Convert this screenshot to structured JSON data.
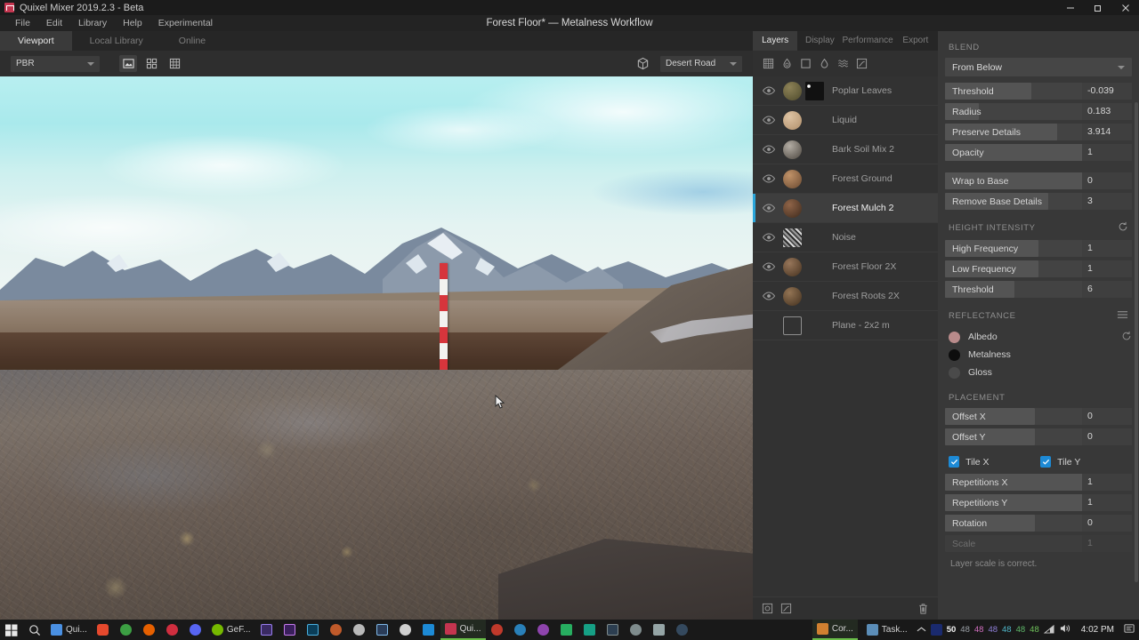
{
  "window": {
    "app_title": "Quixel Mixer 2019.2.3 - Beta",
    "document_title": "Forest Floor* — Metalness Workflow",
    "minimize": "minimize-icon",
    "restore": "restore-icon",
    "close": "close-icon"
  },
  "menu": [
    "File",
    "Edit",
    "Library",
    "Help",
    "Experimental"
  ],
  "tabs": [
    {
      "label": "Viewport",
      "active": true
    },
    {
      "label": "Local Library",
      "active": false
    },
    {
      "label": "Online",
      "active": false
    }
  ],
  "viewport_toolbar": {
    "shader_mode": "PBR",
    "view_icons": [
      "image-view-icon",
      "grid-four-view-icon",
      "grid-nine-view-icon"
    ],
    "environment_icon": "cube-icon",
    "environment": "Desert Road"
  },
  "panel_tabs": [
    {
      "label": "Layers",
      "active": true
    },
    {
      "label": "Display",
      "active": false
    },
    {
      "label": "Performance",
      "active": false
    },
    {
      "label": "Export",
      "active": false
    }
  ],
  "layer_tools": [
    "material-grid-icon",
    "paint-layer-icon",
    "solid-layer-icon",
    "liquid-layer-icon",
    "displace-layer-icon",
    "curve-layer-icon"
  ],
  "layers": [
    {
      "name": "Poplar Leaves",
      "thumb": "#6b6142",
      "mask": "stencil",
      "visible": true,
      "selected": false
    },
    {
      "name": "Liquid",
      "thumb": "#c2a487",
      "mask": null,
      "visible": true,
      "selected": false
    },
    {
      "name": "Bark Soil Mix 2",
      "thumb": "#8d857c",
      "mask": null,
      "visible": true,
      "selected": false
    },
    {
      "name": "Forest Ground",
      "thumb": "#9b7352",
      "mask": null,
      "visible": true,
      "selected": false
    },
    {
      "name": "Forest Mulch 2",
      "thumb": "#6e4c38",
      "mask": null,
      "visible": true,
      "selected": true
    },
    {
      "name": "Noise",
      "thumb": null,
      "mask": "noise",
      "visible": true,
      "selected": false
    },
    {
      "name": "Forest Floor 2X",
      "thumb": "#6d5540",
      "mask": null,
      "visible": true,
      "selected": false
    },
    {
      "name": "Forest Roots 2X",
      "thumb": "#6a5239",
      "mask": null,
      "visible": true,
      "selected": false
    },
    {
      "name": "Plane - 2x2 m",
      "thumb": null,
      "mask": null,
      "visible": false,
      "selected": false
    }
  ],
  "layer_footer": {
    "add_icon": "add-layer-icon",
    "curve_icon": "curve-icon",
    "delete_icon": "trash-icon"
  },
  "properties": {
    "blend": {
      "heading": "BLEND",
      "mode": "From Below",
      "sliders": [
        {
          "label": "Threshold",
          "value": "-0.039",
          "fill": 46
        },
        {
          "label": "Radius",
          "value": "0.183",
          "fill": 18
        },
        {
          "label": "Preserve Details",
          "value": "3.914",
          "fill": 60
        },
        {
          "label": "Opacity",
          "value": "1",
          "fill": 100
        }
      ]
    },
    "base": {
      "sliders": [
        {
          "label": "Wrap to Base",
          "value": "0",
          "fill": 100
        },
        {
          "label": "Remove Base Details",
          "value": "3",
          "fill": 55
        }
      ]
    },
    "height_intensity": {
      "heading": "HEIGHT INTENSITY",
      "reset_icon": "reset-icon",
      "sliders": [
        {
          "label": "High Frequency",
          "value": "1",
          "fill": 50
        },
        {
          "label": "Low Frequency",
          "value": "1",
          "fill": 50
        },
        {
          "label": "Threshold",
          "value": "6",
          "fill": 37
        }
      ]
    },
    "reflectance": {
      "heading": "REFLECTANCE",
      "menu_icon": "hamburger-icon",
      "reset_icon": "reset-icon",
      "channels": [
        {
          "name": "Albedo",
          "color": "#b98b8b"
        },
        {
          "name": "Metalness",
          "color": "#0d0d0d"
        },
        {
          "name": "Gloss",
          "color": "#4a4a4a"
        }
      ]
    },
    "placement": {
      "heading": "PLACEMENT",
      "sliders": [
        {
          "label": "Offset X",
          "value": "0",
          "fill": 48
        },
        {
          "label": "Offset Y",
          "value": "0",
          "fill": 48
        }
      ]
    },
    "tiling": {
      "tile_x_label": "Tile X",
      "tile_y_label": "Tile Y",
      "tile_x_checked": true,
      "tile_y_checked": true,
      "check_color": "#1d8ad6",
      "sliders": [
        {
          "label": "Repetitions X",
          "value": "1",
          "fill": 100,
          "disabled": false
        },
        {
          "label": "Repetitions Y",
          "value": "1",
          "fill": 100,
          "disabled": false
        },
        {
          "label": "Rotation",
          "value": "0",
          "fill": 48,
          "disabled": false
        },
        {
          "label": "Scale",
          "value": "1",
          "fill": 0,
          "disabled": true
        }
      ],
      "note": "Layer scale is correct."
    }
  },
  "taskbar": {
    "start_icon": "windows-start-icon",
    "search_icon": "search-icon",
    "pinned": [
      {
        "name": "Quixel Bridge",
        "label": "Qui...",
        "color": "#4a90e2",
        "icon": "bridge-icon"
      },
      {
        "name": "Brave",
        "label": "",
        "color": "#e6492d",
        "icon": "brave-icon"
      },
      {
        "name": "Chrome",
        "label": "",
        "color": "#3c9f43",
        "icon": "chrome-icon"
      },
      {
        "name": "Firefox",
        "label": "",
        "color": "#e66000",
        "icon": "firefox-icon"
      },
      {
        "name": "Recorder",
        "label": "",
        "color": "#d02e3f",
        "icon": "record-icon"
      },
      {
        "name": "Discord",
        "label": "",
        "color": "#5865f2",
        "icon": "discord-icon"
      },
      {
        "name": "GeForce Experience",
        "label": "GeF...",
        "color": "#76b900",
        "icon": "geforce-icon"
      },
      {
        "name": "After Effects",
        "label": "",
        "color": "#3a2a63",
        "icon": "ae-icon"
      },
      {
        "name": "Premiere Pro",
        "label": "",
        "color": "#3a1f5c",
        "icon": "pr-icon"
      },
      {
        "name": "Photoshop",
        "label": "",
        "color": "#0a3d58",
        "icon": "ps-icon"
      },
      {
        "name": "Cinema 4D",
        "label": "",
        "color": "#c05a2a",
        "icon": "c4d-icon"
      },
      {
        "name": "Blender",
        "label": "",
        "color": "#e87d0d",
        "icon": "blender-icon"
      },
      {
        "name": "Vegas",
        "label": "",
        "color": "#2a6fb0",
        "icon": "vegas-icon"
      },
      {
        "name": "Substance",
        "label": "",
        "color": "#d0d0d0",
        "icon": "substance-icon"
      },
      {
        "name": "Blue App",
        "label": "",
        "color": "#1d8ad6",
        "icon": "blue-app-icon"
      },
      {
        "name": "Quixel Mixer",
        "label": "Qui...",
        "color": "#c4354f",
        "icon": "mixer-icon"
      },
      {
        "name": "App 17",
        "label": "",
        "color": "#c0392b",
        "icon": "app-icon"
      },
      {
        "name": "App 18",
        "label": "",
        "color": "#2980b9",
        "icon": "app-icon"
      },
      {
        "name": "App 19",
        "label": "",
        "color": "#8e44ad",
        "icon": "app-icon"
      },
      {
        "name": "App 20",
        "label": "",
        "color": "#27ae60",
        "icon": "app-icon"
      },
      {
        "name": "App 21",
        "label": "",
        "color": "#16a085",
        "icon": "app-icon"
      },
      {
        "name": "App 22",
        "label": "",
        "color": "#2c3e50",
        "icon": "app-icon"
      },
      {
        "name": "App 23",
        "label": "",
        "color": "#7f8c8d",
        "icon": "app-icon"
      },
      {
        "name": "App 24",
        "label": "",
        "color": "#95a5a6",
        "icon": "app-icon"
      },
      {
        "name": "App 25",
        "label": "",
        "color": "#34495e",
        "icon": "app-icon"
      }
    ],
    "running": [
      {
        "name": "CoreTemp",
        "label": "Cor...",
        "color": "#d08030",
        "icon": "coretemp-icon"
      },
      {
        "name": "Task Manager",
        "label": "Task...",
        "color": "#5b8db8",
        "icon": "taskmanager-icon"
      }
    ],
    "tray": {
      "chevron": "chevron-up-icon",
      "hardware_monitor": [
        {
          "value": "50",
          "color": "#f2f2f2"
        },
        {
          "value": "48",
          "color": "#9aa0a6"
        },
        {
          "value": "48",
          "color": "#d36fc0"
        },
        {
          "value": "48",
          "color": "#8f7fd8"
        },
        {
          "value": "48",
          "color": "#4fb6c8"
        },
        {
          "value": "48",
          "color": "#5fb86a"
        },
        {
          "value": "48",
          "color": "#6fc25a"
        }
      ],
      "network_icon": "network-icon",
      "volume_icon": "volume-icon",
      "clock": "4:02 PM",
      "notifications_icon": "notifications-icon"
    }
  }
}
